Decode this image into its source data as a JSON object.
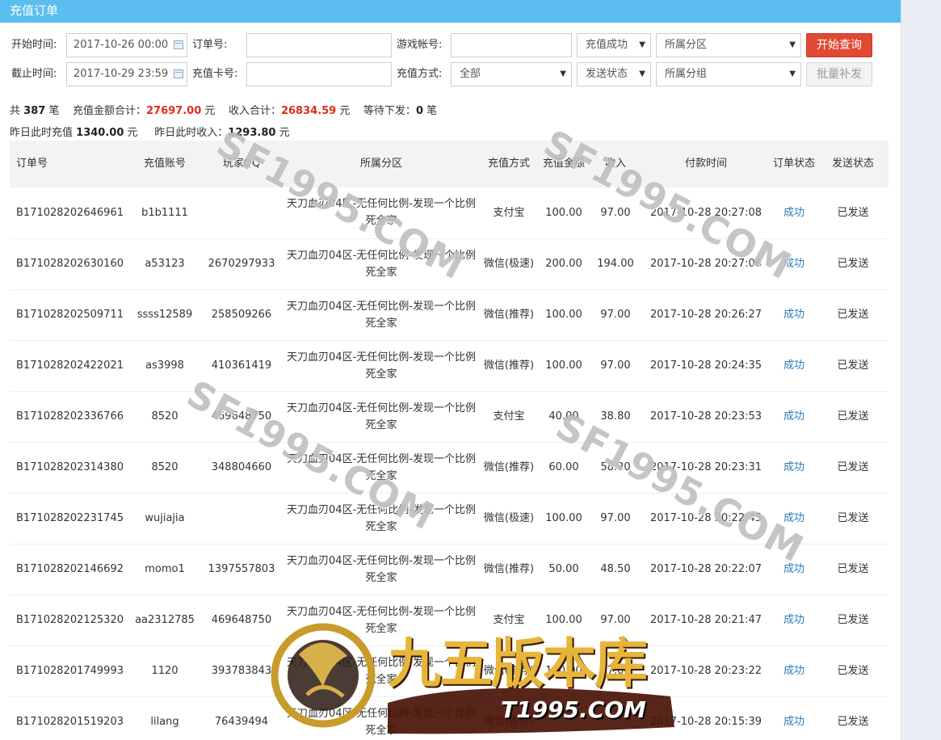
{
  "page": {
    "title": "充值订单"
  },
  "filters": {
    "start_label": "开始时间:",
    "start_value": "2017-10-26 00:00",
    "end_label": "截止时间:",
    "end_value": "2017-10-29 23:59",
    "order_label": "订单号:",
    "order_value": "",
    "card_label": "充值卡号:",
    "card_value": "",
    "game_account_label": "游戏帐号:",
    "game_account_value": "",
    "method_label": "充值方式:",
    "method_value": "全部",
    "status_value": "充值成功",
    "send_status_value": "发送状态",
    "zone_value": "所属分区",
    "group_value": "所属分组",
    "search_button": "开始查询",
    "batch_button": "批量补发"
  },
  "summary": {
    "total_prefix": "共",
    "total_count": "387",
    "total_suffix": "笔",
    "recharge_label": "充值金额合计：",
    "recharge_total": "27697.00",
    "income_label": "收入合计：",
    "income_total": "26834.59",
    "pending_label": "等待下发：",
    "pending_count": "0",
    "currency": "元",
    "yesterday_recharge_label": "昨日此时充值",
    "yesterday_recharge": "1340.00",
    "yesterday_income_label": "昨日此时收入：",
    "yesterday_income": "1293.80"
  },
  "table": {
    "headers": [
      "订单号",
      "充值账号",
      "玩家QQ",
      "所属分区",
      "充值方式",
      "充值金额",
      "收入",
      "付款时间",
      "订单状态",
      "发送状态"
    ],
    "rows": [
      {
        "order": "B171028202646961",
        "account": "b1b1111",
        "qq": "",
        "zone": "天刀血刃04区-无任何比例-发现一个比例死全家",
        "method": "支付宝",
        "amount": "100.00",
        "income": "97.00",
        "time": "2017-10-28 20:27:08",
        "status": "成功",
        "send": "已发送"
      },
      {
        "order": "B171028202630160",
        "account": "a53123",
        "qq": "2670297933",
        "zone": "天刀血刃04区-无任何比例-发现一个比例死全家",
        "method": "微信(极速)",
        "amount": "200.00",
        "income": "194.00",
        "time": "2017-10-28 20:27:06",
        "status": "成功",
        "send": "已发送"
      },
      {
        "order": "B171028202509711",
        "account": "ssss12589",
        "qq": "258509266",
        "zone": "天刀血刃04区-无任何比例-发现一个比例死全家",
        "method": "微信(推荐)",
        "amount": "100.00",
        "income": "97.00",
        "time": "2017-10-28 20:26:27",
        "status": "成功",
        "send": "已发送"
      },
      {
        "order": "B171028202422021",
        "account": "as3998",
        "qq": "410361419",
        "zone": "天刀血刃04区-无任何比例-发现一个比例死全家",
        "method": "微信(推荐)",
        "amount": "100.00",
        "income": "97.00",
        "time": "2017-10-28 20:24:35",
        "status": "成功",
        "send": "已发送"
      },
      {
        "order": "B171028202336766",
        "account": "8520",
        "qq": "469648750",
        "zone": "天刀血刃04区-无任何比例-发现一个比例死全家",
        "method": "支付宝",
        "amount": "40.00",
        "income": "38.80",
        "time": "2017-10-28 20:23:53",
        "status": "成功",
        "send": "已发送"
      },
      {
        "order": "B171028202314380",
        "account": "8520",
        "qq": "348804660",
        "zone": "天刀血刃04区-无任何比例-发现一个比例死全家",
        "method": "微信(推荐)",
        "amount": "60.00",
        "income": "58.20",
        "time": "2017-10-28 20:23:31",
        "status": "成功",
        "send": "已发送"
      },
      {
        "order": "B171028202231745",
        "account": "wujiajia",
        "qq": "",
        "zone": "天刀血刃04区-无任何比例-发现一个比例死全家",
        "method": "微信(极速)",
        "amount": "100.00",
        "income": "97.00",
        "time": "2017-10-28 20:22:45",
        "status": "成功",
        "send": "已发送"
      },
      {
        "order": "B171028202146692",
        "account": "momo1",
        "qq": "1397557803",
        "zone": "天刀血刃04区-无任何比例-发现一个比例死全家",
        "method": "微信(推荐)",
        "amount": "50.00",
        "income": "48.50",
        "time": "2017-10-28 20:22:07",
        "status": "成功",
        "send": "已发送"
      },
      {
        "order": "B171028202125320",
        "account": "aa2312785",
        "qq": "469648750",
        "zone": "天刀血刃04区-无任何比例-发现一个比例死全家",
        "method": "支付宝",
        "amount": "100.00",
        "income": "97.00",
        "time": "2017-10-28 20:21:47",
        "status": "成功",
        "send": "已发送"
      },
      {
        "order": "B171028201749993",
        "account": "1120",
        "qq": "393783843",
        "zone": "天刀血刃04区-无任何比例-发现一个比例死全家",
        "method": "微信(推荐)",
        "amount": "100.00",
        "income": "97.00",
        "time": "2017-10-28 20:23:22",
        "status": "成功",
        "send": "已发送"
      },
      {
        "order": "B171028201519203",
        "account": "lilang",
        "qq": "76439494",
        "zone": "天刀血刃04区-无任何比例-发现一个比例死全家",
        "method": "微信(推荐)",
        "amount": "",
        "income": "",
        "time": "2017-10-28 20:15:39",
        "status": "成功",
        "send": "已发送"
      }
    ]
  },
  "watermarks": {
    "text": "SF1995.COM",
    "logo_text": "九五版本库",
    "logo_url_text": "T1995.COM"
  },
  "colors": {
    "title_bar": "#5bbdf0",
    "accent_red": "#e22a1e",
    "button_red": "#e04a35",
    "link_blue": "#2a7ab8"
  }
}
